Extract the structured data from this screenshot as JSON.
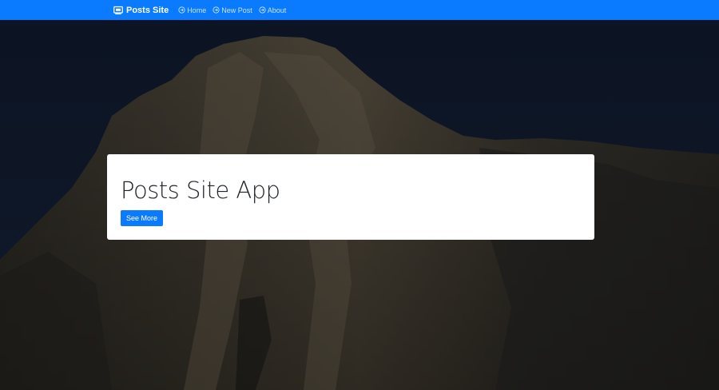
{
  "navbar": {
    "brand": {
      "label": "Posts Site",
      "icon": "monitor-icon"
    },
    "links": [
      {
        "label": "Home",
        "icon": "arrow-circle-right-icon"
      },
      {
        "label": "New Post",
        "icon": "arrow-circle-right-icon"
      },
      {
        "label": "About",
        "icon": "arrow-circle-right-icon"
      }
    ],
    "color": "#0a7bff"
  },
  "hero": {
    "card": {
      "title": "Posts Site App",
      "button_label": "See More"
    }
  }
}
